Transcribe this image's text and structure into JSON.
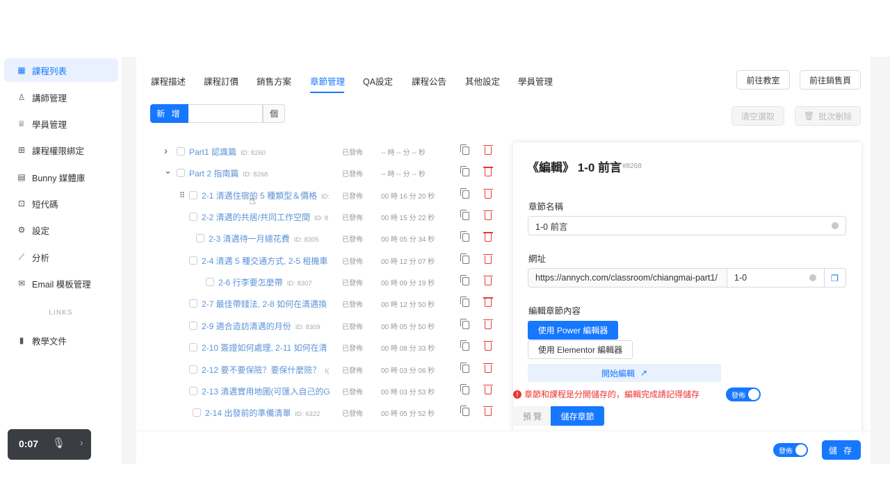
{
  "sidebar": {
    "items": [
      {
        "label": "課程列表",
        "icon": "grid-icon",
        "active": true
      },
      {
        "label": "講師管理",
        "icon": "user-icon"
      },
      {
        "label": "學員管理",
        "icon": "student-icon"
      },
      {
        "label": "課程權限綁定",
        "icon": "apps-icon"
      },
      {
        "label": "Bunny 媒體庫",
        "icon": "media-icon"
      },
      {
        "label": "短代碼",
        "icon": "code-icon"
      },
      {
        "label": "設定",
        "icon": "gear-icon"
      },
      {
        "label": "分析",
        "icon": "chart-icon"
      },
      {
        "label": "Email 模板管理",
        "icon": "mail-icon"
      }
    ],
    "links_label": "LINKS",
    "links": [
      {
        "label": "教學文件",
        "icon": "book-icon"
      }
    ]
  },
  "tabs": [
    {
      "label": "課程描述"
    },
    {
      "label": "課程訂價"
    },
    {
      "label": "銷售方案"
    },
    {
      "label": "章節管理",
      "active": true
    },
    {
      "label": "QA設定"
    },
    {
      "label": "課程公告"
    },
    {
      "label": "其他設定"
    },
    {
      "label": "學員管理"
    }
  ],
  "header_buttons": {
    "classroom": "前往教室",
    "sales": "前往銷售頁"
  },
  "add_bar": {
    "add_label": "新 增",
    "unit": "個",
    "value": ""
  },
  "bulk": {
    "clear": "清空選取",
    "delete": "批次刪除"
  },
  "chapters": [
    {
      "title": "Part1 認識篇",
      "id": "ID: 8260",
      "status": "已發佈",
      "duration": "-- 時 -- 分 -- 秒",
      "level": 0,
      "chevron": "right"
    },
    {
      "title": "Part 2 指南篇",
      "id": "ID: 8268",
      "status": "已發佈",
      "duration": "-- 時 -- 分 -- 秒",
      "level": 0,
      "chevron": "down"
    },
    {
      "title": "2-1 清邁住宿的 5 種類型＆價格",
      "id": "ID:",
      "status": "已發佈",
      "duration": "00 時 16 分 20 秒",
      "level": 1,
      "handle": true
    },
    {
      "title": "2-2 清邁的共居/共同工作空間",
      "id": "ID: 8",
      "status": "已發佈",
      "duration": "00 時 15 分 22 秒",
      "level": 1
    },
    {
      "title": "2-3 清邁待一月總花費",
      "id": "ID: 8305",
      "status": "已發佈",
      "duration": "00 時 05 分 34 秒",
      "level": 2
    },
    {
      "title": "2-4 清邁 5 種交通方式, 2-5 租機車",
      "id": "",
      "status": "已發佈",
      "duration": "00 時 12 分 07 秒",
      "level": 1
    },
    {
      "title": "2-6 行李要怎麼帶",
      "id": "ID: 8307",
      "status": "已發佈",
      "duration": "00 時 09 分 19 秒",
      "level": 3
    },
    {
      "title": "2-7 最佳帶錢法, 2-8 如何在清邁換",
      "id": "",
      "status": "已發佈",
      "duration": "00 時 12 分 50 秒",
      "level": 1
    },
    {
      "title": "2-9 適合造訪清邁的月份",
      "id": "ID: 8309",
      "status": "已發佈",
      "duration": "00 時 05 分 50 秒",
      "level": 1
    },
    {
      "title": "2-10 簽證如何處理, 2-11 如何在清",
      "id": "",
      "status": "已發佈",
      "duration": "00 時 08 分 33 秒",
      "level": 1
    },
    {
      "title": "2-12 要不要保險？要保什麼險？",
      "id": "I(",
      "status": "已發佈",
      "duration": "00 時 03 分 06 秒",
      "level": 1
    },
    {
      "title": "2-13 清邁實用地圖(可匯入自己的G",
      "id": "",
      "status": "已發佈",
      "duration": "00 時 03 分 53 秒",
      "level": 1
    },
    {
      "title": "2-14 出發前的準備清單",
      "id": "ID: 6322",
      "status": "已發佈",
      "duration": "00 時 05 分 52 秒",
      "level": 4
    }
  ],
  "editor": {
    "title": "《編輯》 1-0 前言",
    "id": "#8268",
    "name_label": "章節名稱",
    "name_value": "1-0 前言",
    "url_label": "網址",
    "url_base": "https://annych.com/classroom/chiangmai-part1/",
    "url_slug": "1-0",
    "content_label": "編輯章節內容",
    "power_editor": "使用 Power 編輯器",
    "elementor_editor": "使用 Elementor 編輯器",
    "start_edit": "開始編輯",
    "warning": "章節和課程是分開儲存的，編輯完成請記得儲存",
    "publish_toggle": "發佈",
    "preview": "預 覽",
    "save_chapter": "儲存章節"
  },
  "footer": {
    "publish_toggle": "發佈",
    "save": "儲 存"
  },
  "recorder": {
    "time": "0:07"
  }
}
